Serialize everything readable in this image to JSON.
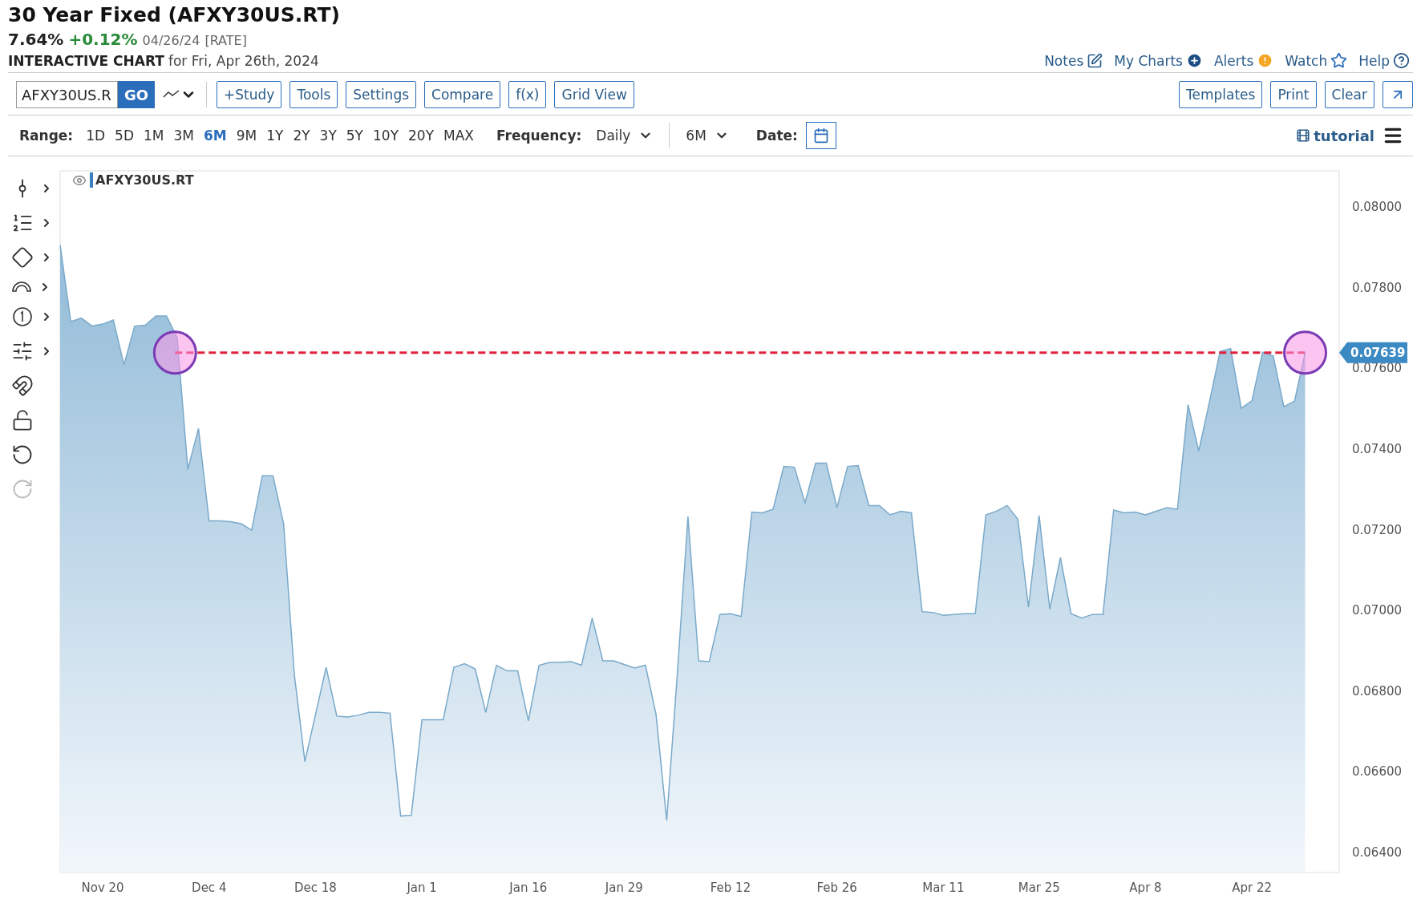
{
  "header": {
    "title": "30 Year Fixed (AFXY30US.RT)",
    "last": "7.64%",
    "change": "+0.12%",
    "date": "04/26/24",
    "tag": "[RATE]",
    "subtitle_bold": "INTERACTIVE CHART",
    "subtitle": "for Fri, Apr 26th, 2024"
  },
  "top_links": [
    {
      "label": "Notes",
      "kind": "notes"
    },
    {
      "label": "My Charts",
      "kind": "add"
    },
    {
      "label": "Alerts",
      "kind": "alert"
    },
    {
      "label": "Watch",
      "kind": "star"
    },
    {
      "label": "Help",
      "kind": "help"
    }
  ],
  "toolbar": {
    "symbol": "AFXY30US.R",
    "go": "GO",
    "buttons": [
      "+Study",
      "Tools",
      "Settings",
      "Compare",
      "f(x)",
      "Grid View"
    ],
    "right_buttons": [
      "Templates",
      "Print",
      "Clear"
    ]
  },
  "range": {
    "label": "Range:",
    "options": [
      {
        "label": "1D",
        "selected": false
      },
      {
        "label": "5D",
        "selected": false
      },
      {
        "label": "1M",
        "selected": false
      },
      {
        "label": "3M",
        "selected": false
      },
      {
        "label": "6M",
        "selected": true
      },
      {
        "label": "9M",
        "selected": false
      },
      {
        "label": "1Y",
        "selected": false
      },
      {
        "label": "2Y",
        "selected": false
      },
      {
        "label": "3Y",
        "selected": false
      },
      {
        "label": "5Y",
        "selected": false
      },
      {
        "label": "10Y",
        "selected": false
      },
      {
        "label": "20Y",
        "selected": false
      },
      {
        "label": "MAX",
        "selected": false
      }
    ]
  },
  "frequency": {
    "label": "Frequency:",
    "value": "Daily"
  },
  "period": {
    "value": "6M"
  },
  "date": {
    "label": "Date:"
  },
  "tutorial": "tutorial",
  "tools": [
    {
      "kind": "crosshair",
      "menu": true,
      "disabled": false
    },
    {
      "kind": "fib",
      "menu": true,
      "disabled": false
    },
    {
      "kind": "shape",
      "menu": true,
      "disabled": false
    },
    {
      "kind": "arc",
      "menu": true,
      "disabled": false
    },
    {
      "kind": "number",
      "menu": true,
      "disabled": false
    },
    {
      "kind": "measure",
      "menu": true,
      "disabled": false
    },
    {
      "kind": "magnet",
      "menu": false,
      "disabled": false
    },
    {
      "kind": "lock",
      "menu": false,
      "disabled": false
    },
    {
      "kind": "undo",
      "menu": false,
      "disabled": false
    },
    {
      "kind": "redo",
      "menu": false,
      "disabled": true
    }
  ],
  "chart_data": {
    "type": "area",
    "ylim": [
      0.0635,
      0.0809
    ],
    "categories": [
      null,
      null,
      null,
      null,
      "Nov 20",
      null,
      null,
      null,
      null,
      null,
      null,
      null,
      null,
      null,
      "Dec 4",
      null,
      null,
      null,
      null,
      null,
      null,
      null,
      null,
      null,
      "Dec 18",
      null,
      null,
      null,
      null,
      null,
      null,
      null,
      null,
      null,
      "Jan 1",
      null,
      null,
      null,
      null,
      null,
      null,
      null,
      null,
      null,
      "Jan 16",
      null,
      null,
      null,
      null,
      null,
      null,
      null,
      null,
      "Jan 29",
      null,
      null,
      null,
      null,
      null,
      null,
      null,
      null,
      null,
      "Feb 12",
      null,
      null,
      null,
      null,
      null,
      null,
      null,
      null,
      null,
      "Feb 26",
      null,
      null,
      null,
      null,
      null,
      null,
      null,
      null,
      null,
      "Mar 11",
      null,
      null,
      null,
      null,
      null,
      null,
      null,
      null,
      "Mar 25",
      null,
      null,
      null,
      null,
      null,
      null,
      null,
      null,
      null,
      "Apr 8",
      null,
      null,
      null,
      null,
      null,
      null,
      null,
      null,
      null,
      "Apr 22",
      null,
      null,
      null,
      null,
      null
    ],
    "series": [
      {
        "name": "AFXY30US.RT",
        "color": "#7aa9c9",
        "values": [
          0.07906,
          0.07716,
          0.07725,
          0.07705,
          0.0771,
          0.0772,
          0.07609,
          0.07705,
          0.07707,
          0.0773,
          0.0773,
          0.07676,
          0.0735,
          0.07451,
          0.07222,
          0.07222,
          0.0722,
          0.07215,
          0.07199,
          0.07334,
          0.07334,
          0.07215,
          0.06843,
          0.06625,
          0.06742,
          0.06859,
          0.06738,
          0.06736,
          0.0674,
          0.06747,
          0.06747,
          0.06745,
          0.0649,
          0.06492,
          0.06729,
          0.06729,
          0.06729,
          0.06859,
          0.06868,
          0.06855,
          0.06747,
          0.06864,
          0.0685,
          0.0685,
          0.06726,
          0.06864,
          0.06871,
          0.06871,
          0.06873,
          0.06864,
          0.06981,
          0.06875,
          0.06875,
          0.06866,
          0.06857,
          0.06864,
          0.06742,
          0.06479,
          0.06843,
          0.07233,
          0.06875,
          0.06873,
          0.0699,
          0.06992,
          0.06985,
          0.07244,
          0.07242,
          0.07251,
          0.07357,
          0.07355,
          0.07267,
          0.07365,
          0.07365,
          0.07255,
          0.07357,
          0.07359,
          0.0726,
          0.0726,
          0.07237,
          0.07246,
          0.07242,
          0.06997,
          0.06995,
          0.06988,
          0.0699,
          0.06992,
          0.06992,
          0.07237,
          0.07246,
          0.0726,
          0.07226,
          0.07008,
          0.07235,
          0.07003,
          0.07131,
          0.06992,
          0.06981,
          0.0699,
          0.0699,
          0.07249,
          0.07242,
          0.07244,
          0.07237,
          0.07246,
          0.07255,
          0.07251,
          0.0751,
          0.07395,
          0.07516,
          0.07642,
          0.07649,
          0.07501,
          0.0752,
          0.0764,
          0.07631,
          0.07505,
          0.07519,
          0.07639
        ]
      }
    ],
    "yticks": [
      {
        "value": 0.064,
        "label": "0.06400"
      },
      {
        "value": 0.066,
        "label": "0.06600"
      },
      {
        "value": 0.068,
        "label": "0.06800"
      },
      {
        "value": 0.07,
        "label": "0.07000"
      },
      {
        "value": 0.072,
        "label": "0.07200"
      },
      {
        "value": 0.074,
        "label": "0.07400"
      },
      {
        "value": 0.076,
        "label": "0.07600"
      },
      {
        "value": 0.078,
        "label": "0.07800"
      },
      {
        "value": 0.08,
        "label": "0.08000"
      }
    ]
  },
  "last_price": {
    "label": "0.07639"
  }
}
